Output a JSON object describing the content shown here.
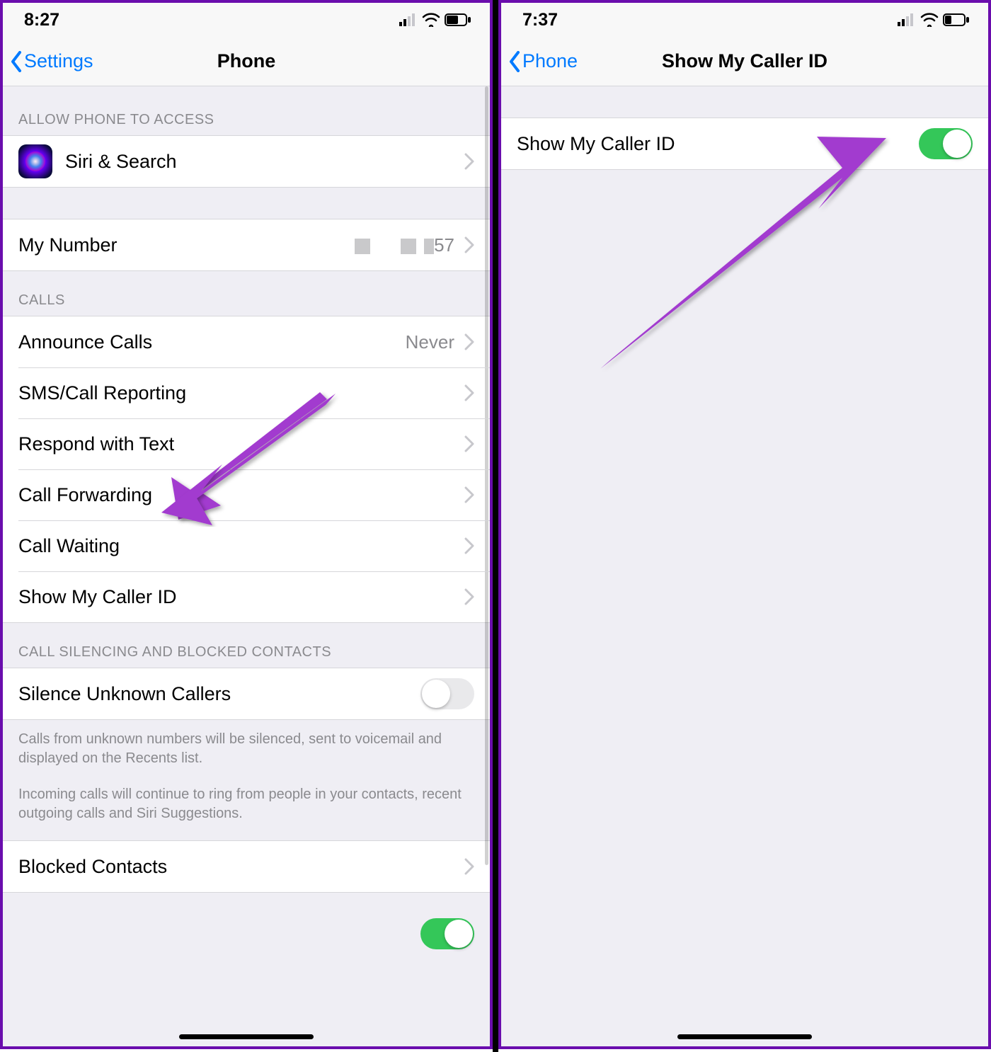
{
  "left": {
    "status_time": "8:27",
    "nav_back": "Settings",
    "nav_title": "Phone",
    "section_access_header": "ALLOW PHONE TO ACCESS",
    "siri_label": "Siri & Search",
    "my_number_label": "My Number",
    "my_number_visible_suffix": "57",
    "section_calls_header": "CALLS",
    "calls": {
      "announce": {
        "label": "Announce Calls",
        "value": "Never"
      },
      "sms": {
        "label": "SMS/Call Reporting"
      },
      "respond": {
        "label": "Respond with Text"
      },
      "forwarding": {
        "label": "Call Forwarding"
      },
      "waiting": {
        "label": "Call Waiting"
      },
      "callerid": {
        "label": "Show My Caller ID"
      }
    },
    "section_blocked_header": "CALL SILENCING AND BLOCKED CONTACTS",
    "silence_label": "Silence Unknown Callers",
    "silence_on": false,
    "footer1": "Calls from unknown numbers will be silenced, sent to voicemail and displayed on the Recents list.",
    "footer2": "Incoming calls will continue to ring from people in your contacts, recent outgoing calls and Siri Suggestions.",
    "blocked_label": "Blocked Contacts"
  },
  "right": {
    "status_time": "7:37",
    "nav_back": "Phone",
    "nav_title": "Show My Caller ID",
    "row_label": "Show My Caller ID",
    "toggle_on": true
  }
}
